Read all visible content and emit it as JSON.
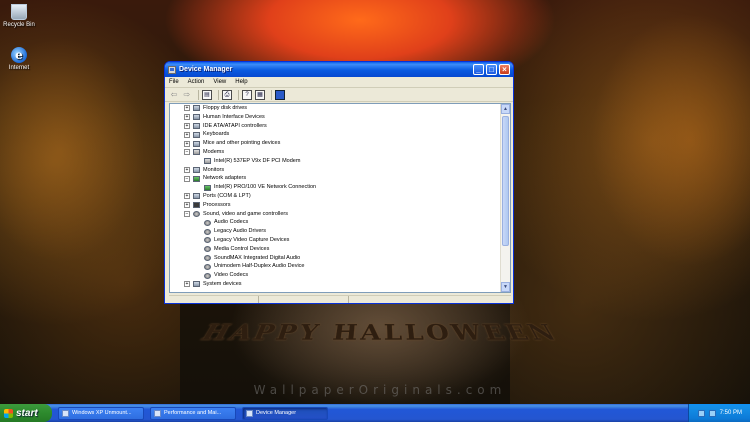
{
  "desktop": {
    "icons": [
      {
        "label": "Recycle Bin"
      },
      {
        "label": "Internet"
      }
    ],
    "wallpaper_text": "HAPPY HALLOWEEN",
    "watermark": "WallpaperOriginals.com"
  },
  "window": {
    "title": "Device Manager",
    "menu": [
      "File",
      "Action",
      "View",
      "Help"
    ],
    "tree": [
      {
        "label": "Floppy disk drives",
        "expander": "+",
        "level": 1
      },
      {
        "label": "Human Interface Devices",
        "expander": "+",
        "level": 1
      },
      {
        "label": "IDE ATA/ATAPI controllers",
        "expander": "+",
        "level": 1
      },
      {
        "label": "Keyboards",
        "expander": "+",
        "level": 1
      },
      {
        "label": "Mice and other pointing devices",
        "expander": "+",
        "level": 1
      },
      {
        "label": "Modems",
        "expander": "−",
        "level": 1
      },
      {
        "label": "Intel(R) 537EP V9x DF PCI Modem",
        "expander": "",
        "level": 2
      },
      {
        "label": "Monitors",
        "expander": "+",
        "level": 1
      },
      {
        "label": "Network adapters",
        "expander": "−",
        "level": 1
      },
      {
        "label": "Intel(R) PRO/100 VE Network Connection",
        "expander": "",
        "level": 2
      },
      {
        "label": "Ports (COM & LPT)",
        "expander": "+",
        "level": 1
      },
      {
        "label": "Processors",
        "expander": "+",
        "level": 1
      },
      {
        "label": "Sound, video and game controllers",
        "expander": "−",
        "level": 1
      },
      {
        "label": "Audio Codecs",
        "expander": "",
        "level": 2
      },
      {
        "label": "Legacy Audio Drivers",
        "expander": "",
        "level": 2
      },
      {
        "label": "Legacy Video Capture Devices",
        "expander": "",
        "level": 2
      },
      {
        "label": "Media Control Devices",
        "expander": "",
        "level": 2
      },
      {
        "label": "SoundMAX Integrated Digital Audio",
        "expander": "",
        "level": 2
      },
      {
        "label": "Unimodem Half-Duplex Audio Device",
        "expander": "",
        "level": 2
      },
      {
        "label": "Video Codecs",
        "expander": "",
        "level": 2
      },
      {
        "label": "System devices",
        "expander": "+",
        "level": 1
      }
    ]
  },
  "taskbar": {
    "start_label": "start",
    "tasks": [
      {
        "label": "Windows XP Unmount..."
      },
      {
        "label": "Performance and Mai..."
      },
      {
        "label": "Device Manager"
      }
    ],
    "clock": "7:50 PM"
  }
}
